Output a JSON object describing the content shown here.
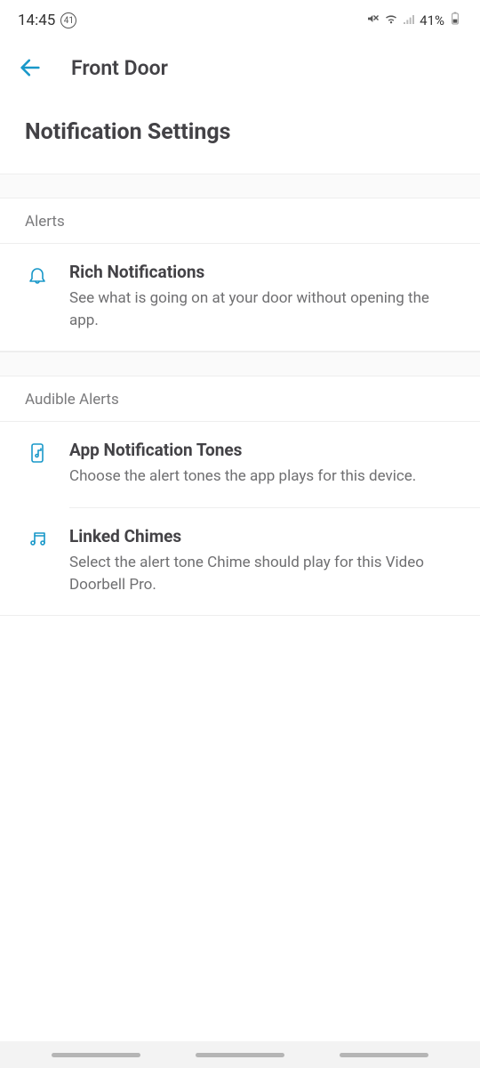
{
  "status_bar": {
    "time": "14:45",
    "notif_count": "41",
    "battery": "41%"
  },
  "header": {
    "title": "Front Door"
  },
  "page": {
    "heading": "Notification Settings"
  },
  "sections": {
    "alerts": {
      "label": "Alerts",
      "items": [
        {
          "title": "Rich Notifications",
          "desc": "See what is going on at your door without opening the app."
        }
      ]
    },
    "audible": {
      "label": "Audible Alerts",
      "items": [
        {
          "title": "App Notification Tones",
          "desc": "Choose the alert tones the app plays for this device."
        },
        {
          "title": "Linked Chimes",
          "desc": "Select the alert tone Chime should play for this Video Doorbell Pro."
        }
      ]
    }
  }
}
